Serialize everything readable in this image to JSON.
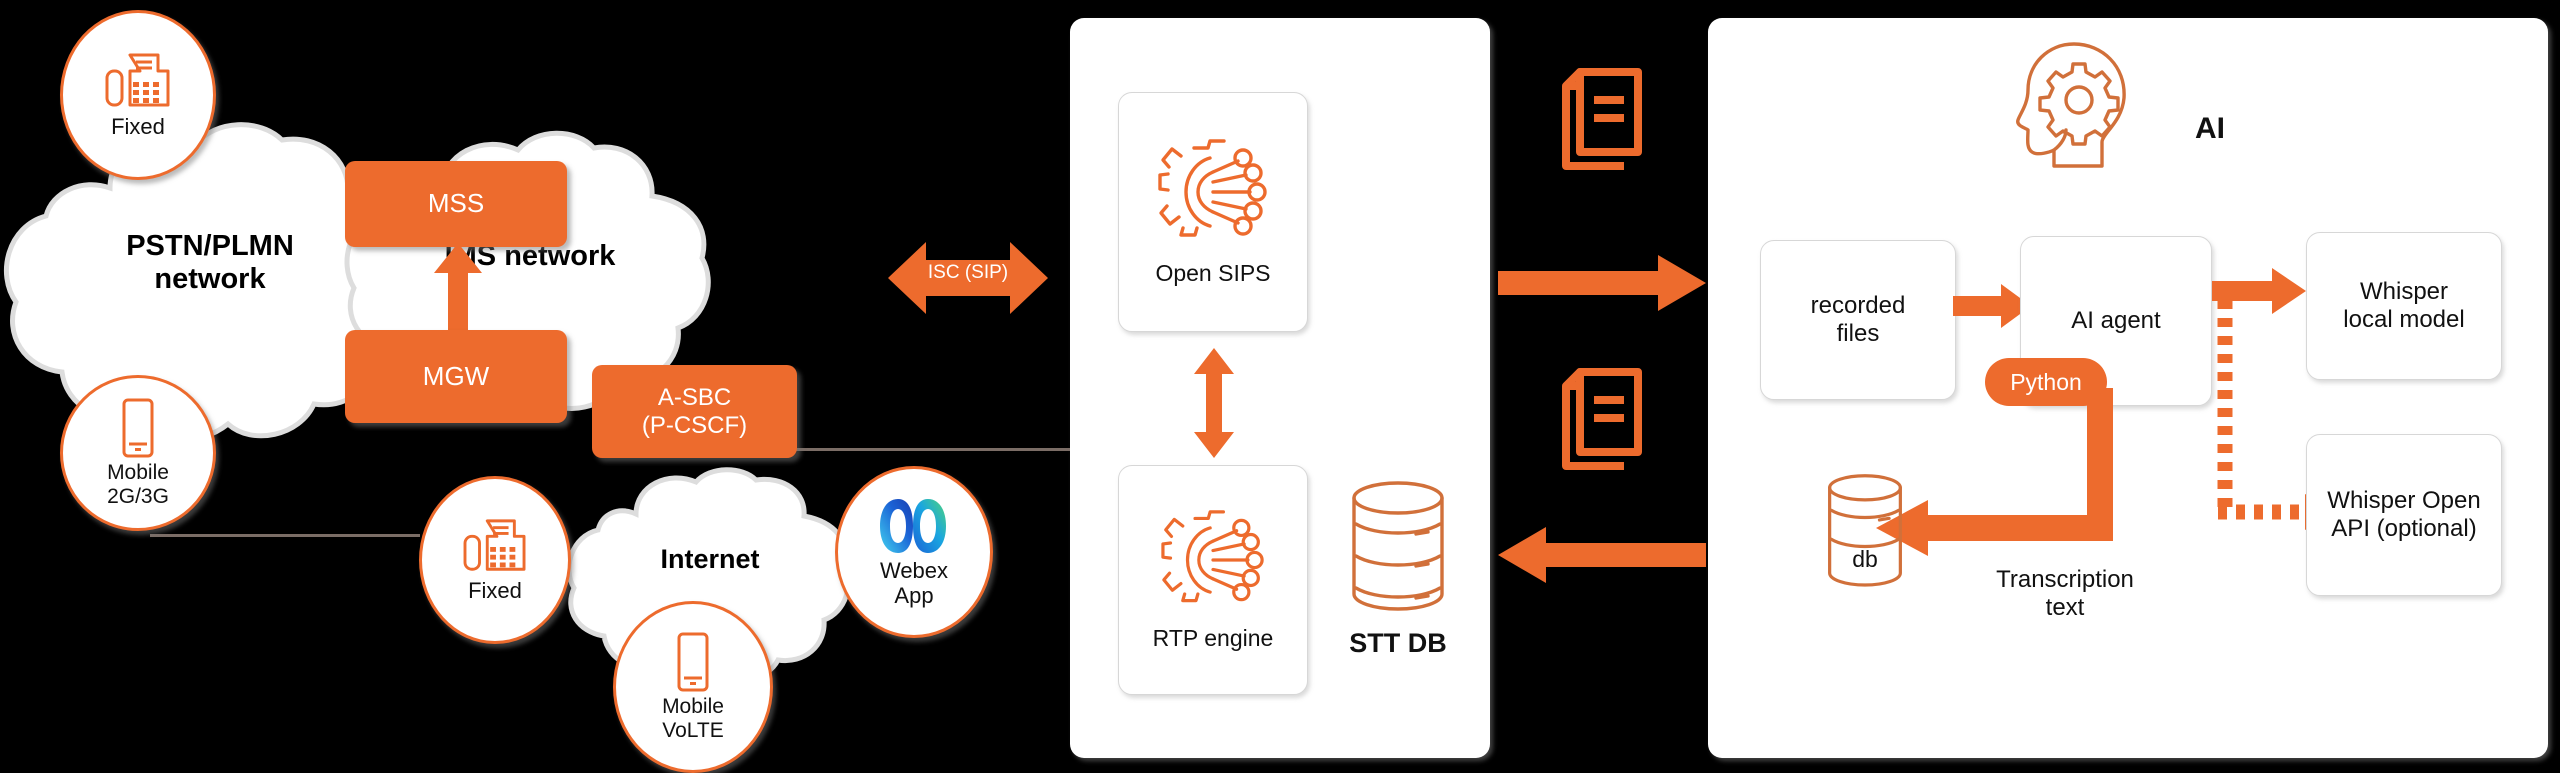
{
  "diagram": {
    "title": "Voice recording and AI transcription architecture",
    "accent_color": "#ED6B2D",
    "background_color": "#000000",
    "panel_color": "#FFFFFF"
  },
  "telecom": {
    "clouds": [
      {
        "id": "pstn",
        "label_line1": "PSTN/PLMN",
        "label_line2": "network"
      },
      {
        "id": "ims",
        "label_line1": "IMS network",
        "label_line2": ""
      },
      {
        "id": "internet",
        "label_line1": "Internet",
        "label_line2": ""
      }
    ],
    "endpoints": [
      {
        "id": "fixed-pstn",
        "label_line1": "Fixed",
        "label_line2": "",
        "icon": "fax-phone-icon"
      },
      {
        "id": "mobile-2g3g",
        "label_line1": "Mobile",
        "label_line2": "2G/3G",
        "icon": "mobile-phone-icon"
      },
      {
        "id": "fixed-internet",
        "label_line1": "Fixed",
        "label_line2": "",
        "icon": "fax-phone-icon"
      },
      {
        "id": "mobile-volte",
        "label_line1": "Mobile",
        "label_line2": "VoLTE",
        "icon": "mobile-phone-icon"
      },
      {
        "id": "webex-app",
        "label_line1": "Webex",
        "label_line2": "App",
        "icon": "webex-logo-icon"
      }
    ],
    "nodes": [
      {
        "id": "mss",
        "label_line1": "MSS",
        "label_line2": ""
      },
      {
        "id": "mgw",
        "label_line1": "MGW",
        "label_line2": ""
      },
      {
        "id": "asbc",
        "label_line1": "A-SBC",
        "label_line2": "(P-CSCF)"
      }
    ],
    "interface_arrow": {
      "label": "ISC (SIP)",
      "direction": "bidirectional"
    }
  },
  "sbc_panel": {
    "cards": [
      {
        "id": "open-sips",
        "label": "Open SIPS",
        "icon": "gear-circuit-icon"
      },
      {
        "id": "rtp-engine",
        "label": "RTP engine",
        "icon": "gear-circuit-icon"
      }
    ],
    "database": {
      "id": "stt-db",
      "label": "STT DB",
      "icon": "database-cylinder-icon"
    },
    "internal_arrow": {
      "direction": "bidirectional"
    }
  },
  "transfer": {
    "top": {
      "icon": "documents-stack-icon",
      "arrow_direction": "right"
    },
    "bottom": {
      "icon": "documents-stack-icon",
      "arrow_direction": "left"
    }
  },
  "ai_panel": {
    "title": "AI",
    "title_icon": "head-gear-icon",
    "boxes": [
      {
        "id": "recorded-files",
        "label_line1": "recorded",
        "label_line2": "files"
      },
      {
        "id": "ai-agent",
        "label_line1": "AI agent",
        "label_line2": ""
      },
      {
        "id": "whisper-local",
        "label_line1": "Whisper",
        "label_line2": "local model"
      },
      {
        "id": "whisper-openapi",
        "label_line1": "Whisper Open",
        "label_line2": "API (optional)"
      }
    ],
    "runtime_pill": {
      "id": "python",
      "label": "Python"
    },
    "database": {
      "id": "db",
      "label": "db",
      "icon": "database-cylinder-icon"
    },
    "flow_label": {
      "id": "transcription-text",
      "label_line1": "Transcription",
      "label_line2": "text"
    },
    "arrows": [
      {
        "id": "files-to-agent",
        "style": "solid",
        "direction": "right"
      },
      {
        "id": "agent-to-whisper-local",
        "style": "solid",
        "direction": "right"
      },
      {
        "id": "agent-to-whisper-openapi",
        "style": "dashed",
        "direction": "right"
      },
      {
        "id": "agent-to-db",
        "style": "solid",
        "direction": "left"
      }
    ]
  }
}
